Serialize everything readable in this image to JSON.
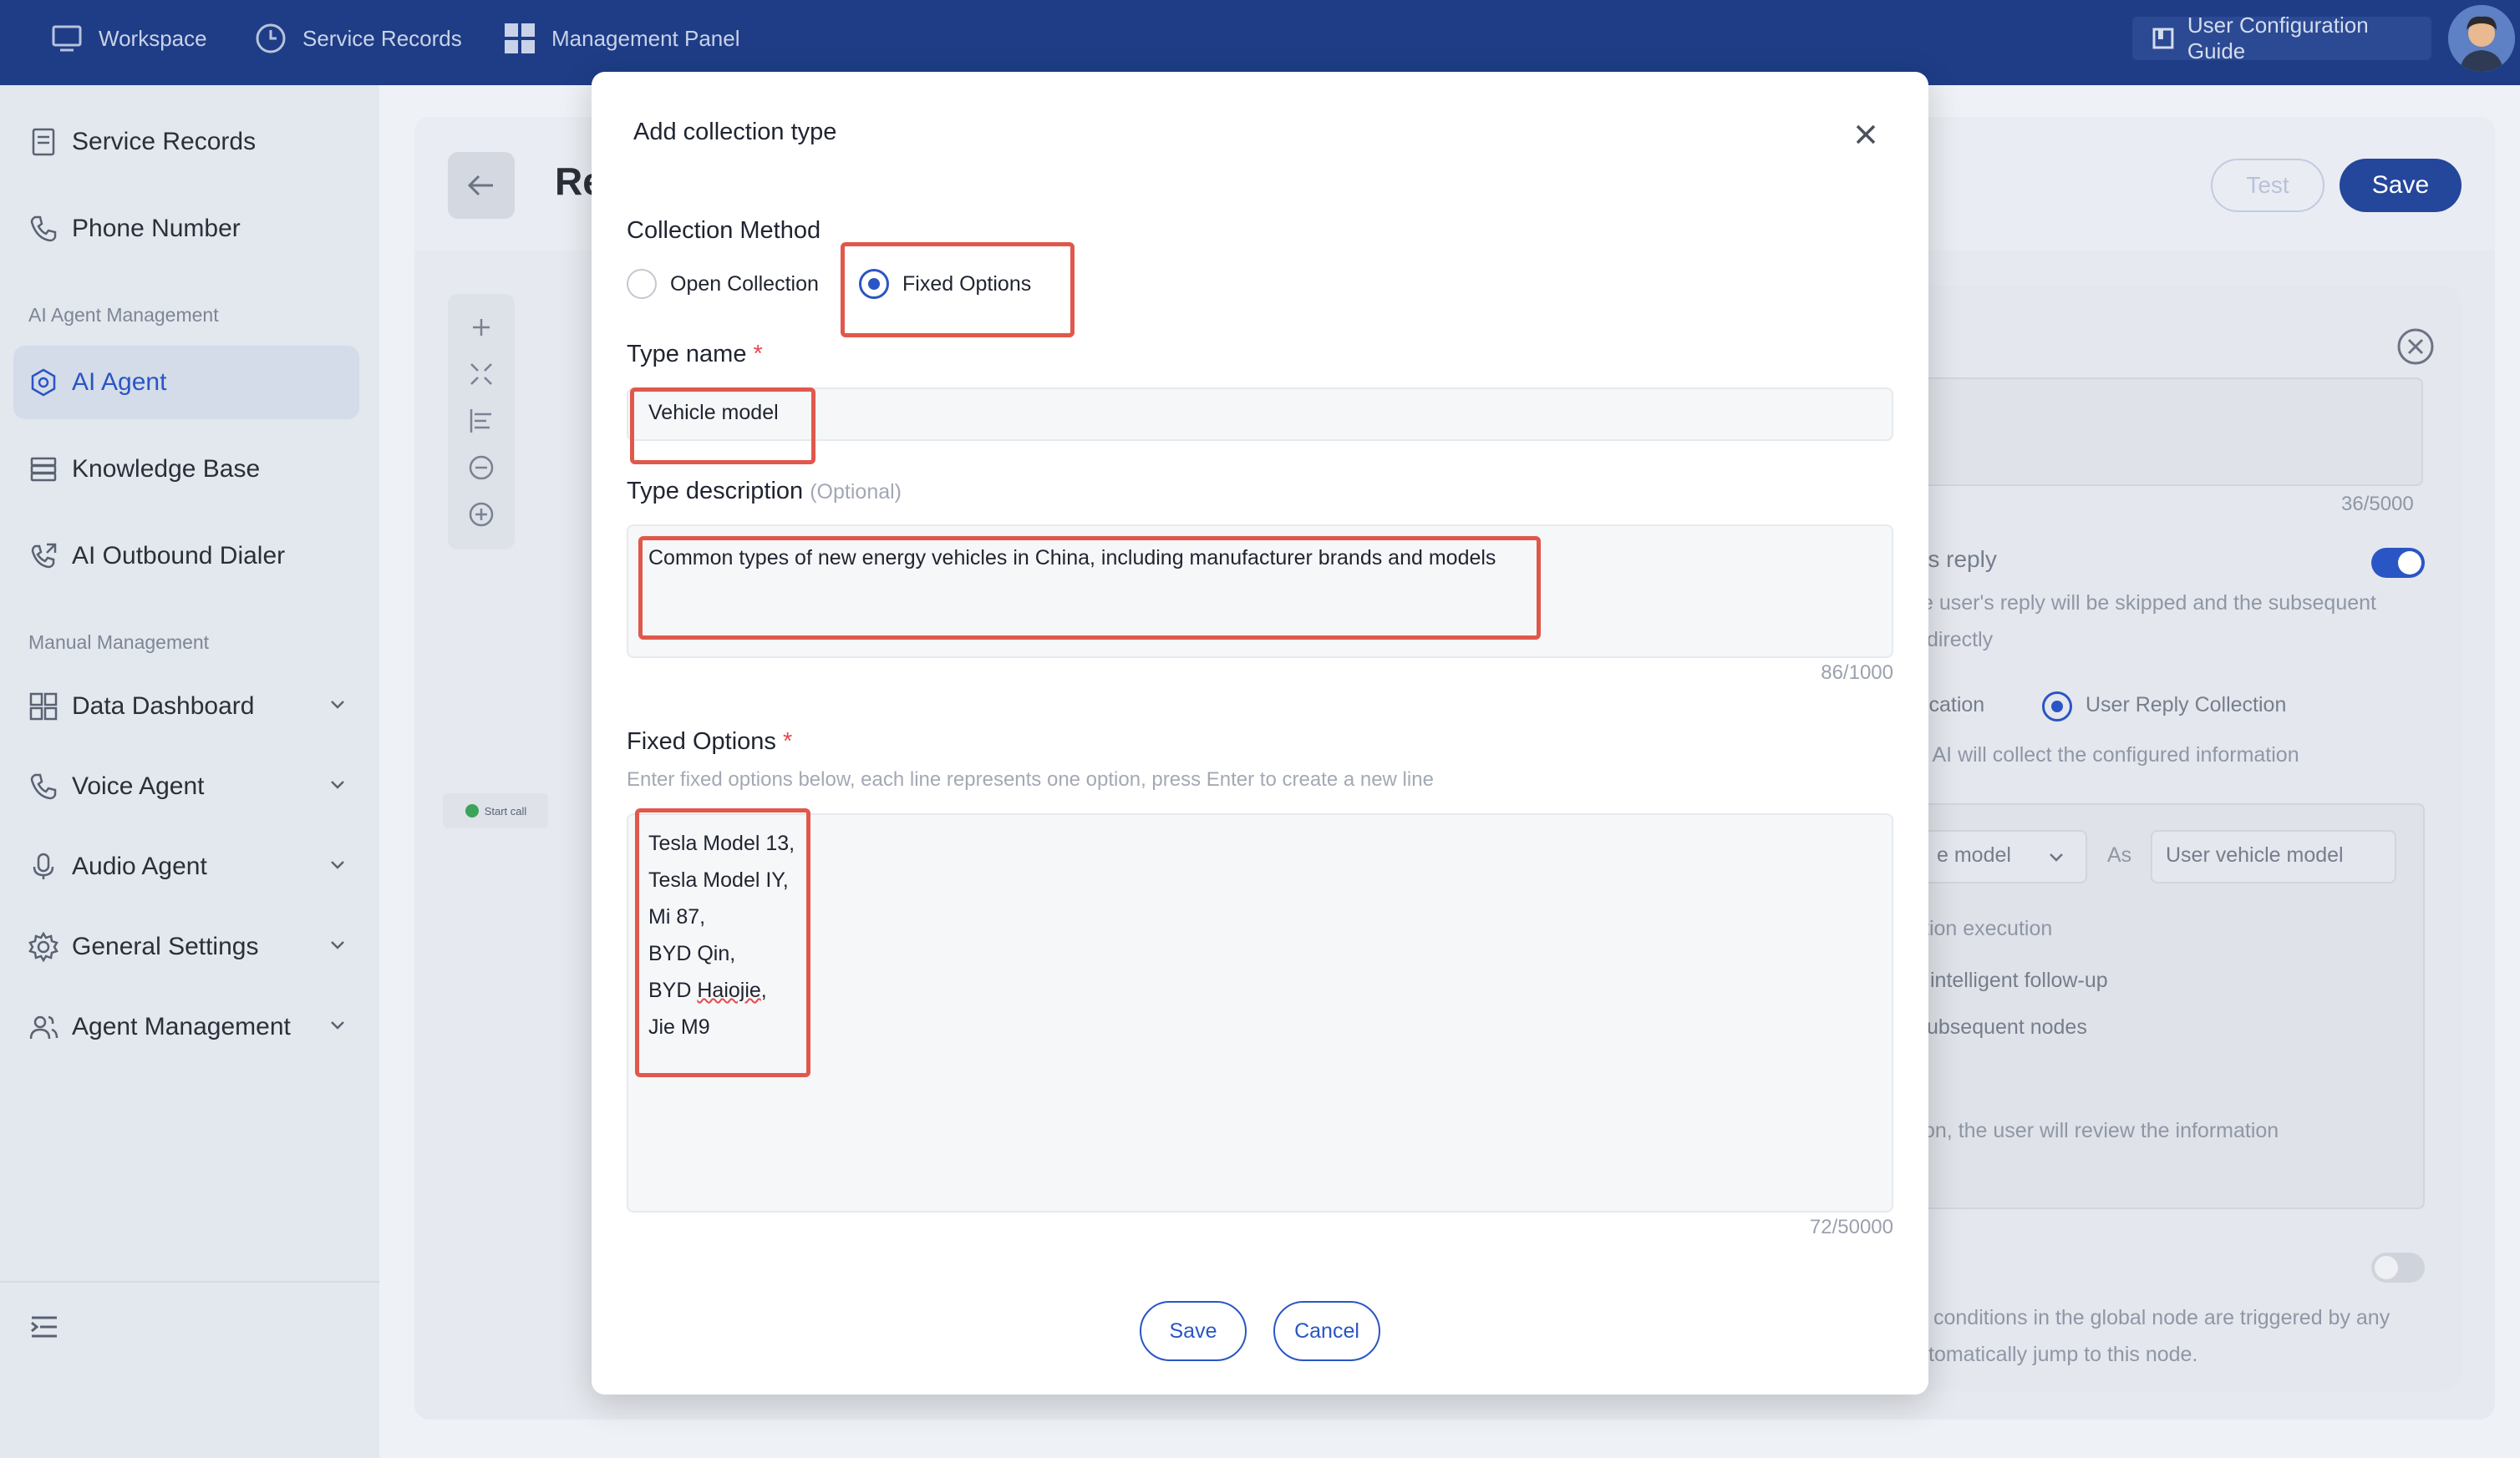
{
  "topbar": {
    "nav": [
      {
        "label": "Workspace",
        "icon": "monitor-icon"
      },
      {
        "label": "Service Records",
        "icon": "clock-icon"
      },
      {
        "label": "Management Panel",
        "icon": "grid-icon"
      }
    ],
    "guide_label": "User Configuration Guide"
  },
  "sidebar": {
    "items_top": [
      {
        "label": "Service Records",
        "icon": "document-icon"
      },
      {
        "label": "Phone Number",
        "icon": "phone-icon"
      }
    ],
    "section_ai": "AI Agent Management",
    "items_ai": [
      {
        "label": "AI Agent",
        "icon": "hexagon-gear-icon",
        "active": true
      },
      {
        "label": "Knowledge Base",
        "icon": "database-icon"
      },
      {
        "label": "AI Outbound Dialer",
        "icon": "outbound-call-icon"
      }
    ],
    "section_manual": "Manual Management",
    "items_manual": [
      {
        "label": "Data Dashboard",
        "icon": "dashboard-icon"
      },
      {
        "label": "Voice Agent",
        "icon": "phone-icon"
      },
      {
        "label": "Audio Agent",
        "icon": "microphone-icon"
      },
      {
        "label": "General Settings",
        "icon": "gear-icon"
      },
      {
        "label": "Agent Management",
        "icon": "users-icon"
      }
    ]
  },
  "editor": {
    "title_partial": "Re",
    "test_label": "Test",
    "save_label": "Save",
    "start_call_label": "Start call",
    "right_panel": {
      "counter": "36/5000",
      "reply_title": "'s reply",
      "reply_desc_1": "e user's reply will be skipped and the subsequent",
      "reply_desc_2": "directly",
      "radio_a": "fication",
      "radio_b": "User Reply Collection",
      "collect_desc": ", AI will collect the configured information",
      "select_value": "e model",
      "as_label": "As",
      "var_value": "User vehicle model",
      "exec_label": "tion execution",
      "follow_label": "intelligent follow-up",
      "subseq_label": "ubsequent nodes",
      "review_text": "on, the user will review the information",
      "global_1": "conditions in the global node are triggered by any",
      "global_2": "tomatically jump to this node."
    }
  },
  "modal": {
    "title": "Add collection type",
    "method_label": "Collection Method",
    "option_open": "Open Collection",
    "option_fixed": "Fixed Options",
    "selected": "Fixed Options",
    "type_name_label": "Type name",
    "required_mark": "*",
    "type_name_value": "Vehicle model",
    "type_desc_label": "Type description",
    "optional_label": "(Optional)",
    "type_desc_value": "Common types of new energy vehicles in China, including manufacturer brands and models",
    "desc_counter": "86/1000",
    "fixed_options_label": "Fixed Options",
    "fixed_options_hint": "Enter fixed options below, each line represents one option, press Enter to create a new line",
    "fixed_options_lines": [
      "Tesla Model 13,",
      "Tesla Model IY,",
      "Mi 87,",
      "BYD Qin,"
    ],
    "line5_prefix": "BYD ",
    "line5_word": "Haiojie",
    "line5_suffix": ",",
    "line6": "Jie M9",
    "options_counter": "72/50000",
    "save_label": "Save",
    "cancel_label": "Cancel"
  },
  "colors": {
    "brand_blue": "#1e3d86",
    "accent": "#2a55c4",
    "highlight_red": "#e0584c"
  }
}
